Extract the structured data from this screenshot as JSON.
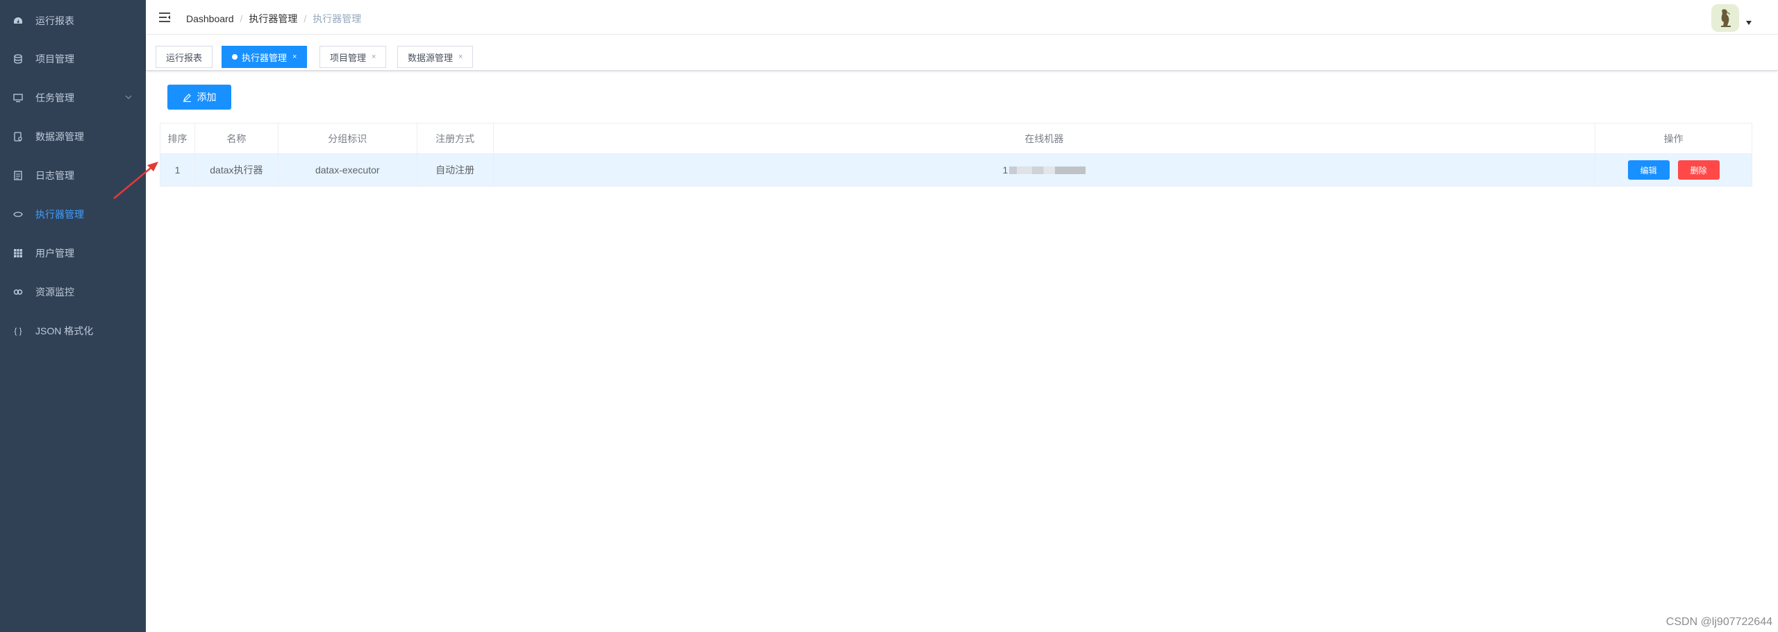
{
  "sidebar": {
    "items": [
      {
        "label": "运行报表",
        "icon": "dashboard-icon"
      },
      {
        "label": "项目管理",
        "icon": "database-icon"
      },
      {
        "label": "任务管理",
        "icon": "monitor-icon",
        "has_submenu": true
      },
      {
        "label": "数据源管理",
        "icon": "datasource-icon"
      },
      {
        "label": "日志管理",
        "icon": "document-icon"
      },
      {
        "label": "执行器管理",
        "icon": "executor-icon",
        "active": true
      },
      {
        "label": "用户管理",
        "icon": "table-icon"
      },
      {
        "label": "资源监控",
        "icon": "link-icon"
      },
      {
        "label": "JSON 格式化",
        "icon": "braces-icon"
      }
    ]
  },
  "header": {
    "breadcrumb": [
      "Dashboard",
      "执行器管理",
      "执行器管理"
    ]
  },
  "tabs": [
    {
      "label": "运行报表",
      "closable": false,
      "active": false
    },
    {
      "label": "执行器管理",
      "closable": true,
      "active": true
    },
    {
      "label": "项目管理",
      "closable": true,
      "active": false
    },
    {
      "label": "数据源管理",
      "closable": true,
      "active": false
    }
  ],
  "toolbar": {
    "add_label": "添加"
  },
  "table": {
    "columns": [
      "排序",
      "名称",
      "分组标识",
      "注册方式",
      "在线机器",
      "操作"
    ],
    "rows": [
      {
        "order": "1",
        "name": "datax执行器",
        "group": "datax-executor",
        "register": "自动注册",
        "online_prefix": "1",
        "edit_label": "编辑",
        "delete_label": "删除"
      }
    ]
  },
  "watermark": "CSDN @lj907722644",
  "colors": {
    "sidebar_bg": "#304156",
    "primary": "#1890ff",
    "danger": "#ff4949",
    "active_menu": "#409eff"
  }
}
